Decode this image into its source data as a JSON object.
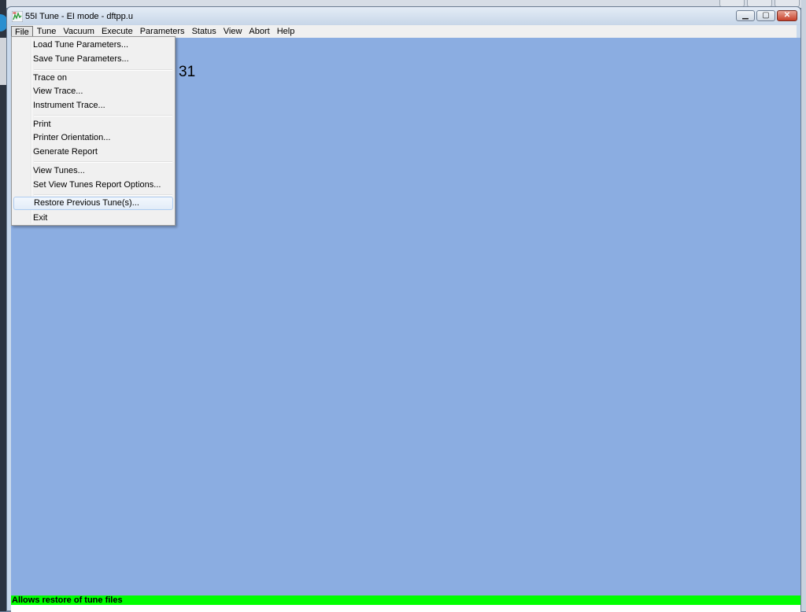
{
  "window": {
    "title": "55I Tune - EI mode - dftpp.u",
    "controls": {
      "minimize": "▁",
      "maximize": "▢",
      "close": "✕"
    }
  },
  "menubar": {
    "items": [
      "File",
      "Tune",
      "Vacuum",
      "Execute",
      "Parameters",
      "Status",
      "View",
      "Abort",
      "Help"
    ]
  },
  "file_menu": {
    "items": [
      {
        "label": "Load Tune Parameters..."
      },
      {
        "label": "Save Tune Parameters..."
      },
      {
        "label": "Trace on"
      },
      {
        "label": "View Trace..."
      },
      {
        "label": "Instrument Trace..."
      },
      {
        "label": "Print"
      },
      {
        "label": "Printer Orientation..."
      },
      {
        "label": "Generate Report"
      },
      {
        "label": "View Tunes..."
      },
      {
        "label": "Set View Tunes Report Options..."
      },
      {
        "label": "Restore Previous Tune(s)..."
      },
      {
        "label": "Exit"
      }
    ],
    "highlighted": "Restore Previous Tune(s)..."
  },
  "client": {
    "partial_text": "31"
  },
  "status_bar": {
    "text": "Allows restore of tune files"
  },
  "colors": {
    "client_background": "#8bade1",
    "status_bar": "#00ff00",
    "menu_background": "#f0f0f0"
  },
  "icons": {
    "app": "tune-app-icon"
  }
}
